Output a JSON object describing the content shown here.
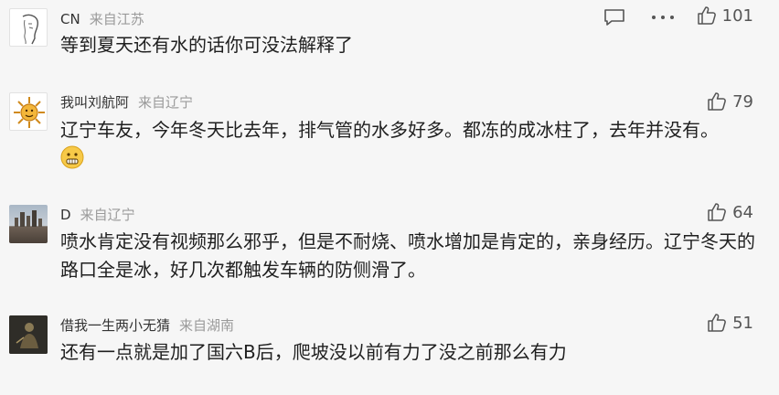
{
  "comments": [
    {
      "user": "CN",
      "location": "来自江苏",
      "text": "等到夏天还有水的话你可没法解释了",
      "likes": "101",
      "avatar": "sketch-face-avatar"
    },
    {
      "user": "我叫刘航阿",
      "location": "来自辽宁",
      "text": "辽宁车友，今年冬天比去年，排气管的水多好多。都冻的成冰柱了，去年并没有。",
      "likes": "79",
      "avatar": "sun-avatar",
      "emoji": "smiley-emoji"
    },
    {
      "user": "D",
      "location": "来自辽宁",
      "text": "喷水肯定没有视频那么邪乎，但是不耐烧、喷水增加是肯定的，亲身经历。辽宁冬天的路口全是冰，好几次都触发车辆的防侧滑了。",
      "likes": "64",
      "avatar": "city-skyline-avatar"
    },
    {
      "user": "借我一生两小无猜",
      "location": "来自湖南",
      "text": "还有一点就是加了国六B后，爬坡没以前有力了没之前那么有力",
      "likes": "51",
      "avatar": "dark-figure-avatar"
    }
  ],
  "colors": {
    "background": "#f6f6f6",
    "meta_gray": "#9a9a9a",
    "icon_gray": "#555555"
  }
}
